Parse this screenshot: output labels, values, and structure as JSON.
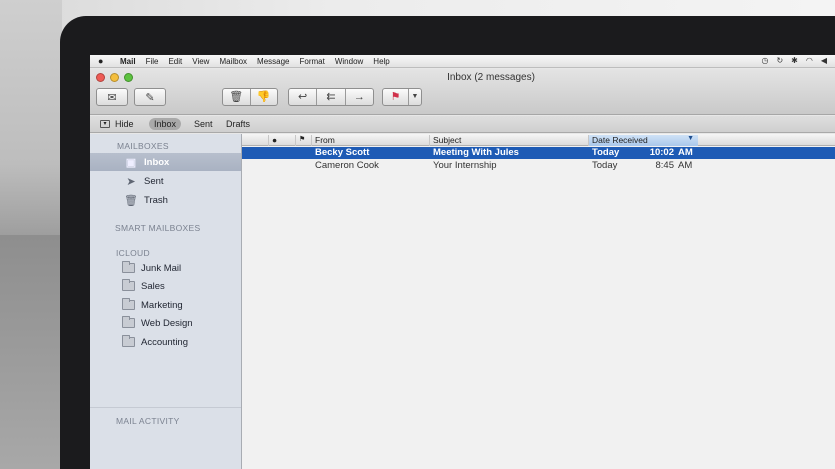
{
  "menubar": {
    "apple": "",
    "items": [
      "Mail",
      "File",
      "Edit",
      "View",
      "Mailbox",
      "Message",
      "Format",
      "Window",
      "Help"
    ]
  },
  "window": {
    "title": "Inbox (2 messages)"
  },
  "toolbar": {
    "icons": [
      "get-mail-icon",
      "compose-icon",
      "delete-icon",
      "junk-icon",
      "reply-icon",
      "reply-all-icon",
      "forward-icon",
      "flag-icon"
    ]
  },
  "favorites": {
    "hide_label": "Hide",
    "items": [
      "Inbox",
      "Sent",
      "Drafts"
    ]
  },
  "sidebar": {
    "mailboxes_header": "MAILBOXES",
    "mailboxes": [
      "Inbox",
      "Sent",
      "Trash"
    ],
    "smart_header": "SMART MAILBOXES",
    "icloud_header": "ICLOUD",
    "icloud": [
      "Junk Mail",
      "Sales",
      "Marketing",
      "Web Design",
      "Accounting"
    ],
    "activity_header": "MAIL ACTIVITY"
  },
  "list": {
    "columns": [
      "From",
      "Subject",
      "Date Received"
    ],
    "messages": [
      {
        "from": "Becky Scott",
        "subject": "Meeting With Jules",
        "date": "Today",
        "time": "10:02",
        "ampm": "AM"
      },
      {
        "from": "Cameron Cook",
        "subject": "Your Internship",
        "date": "Today",
        "time": "8:45",
        "ampm": "AM"
      }
    ]
  },
  "colors": {
    "selection": "#1e5bb5",
    "sidebar": "#dbe0e8"
  }
}
